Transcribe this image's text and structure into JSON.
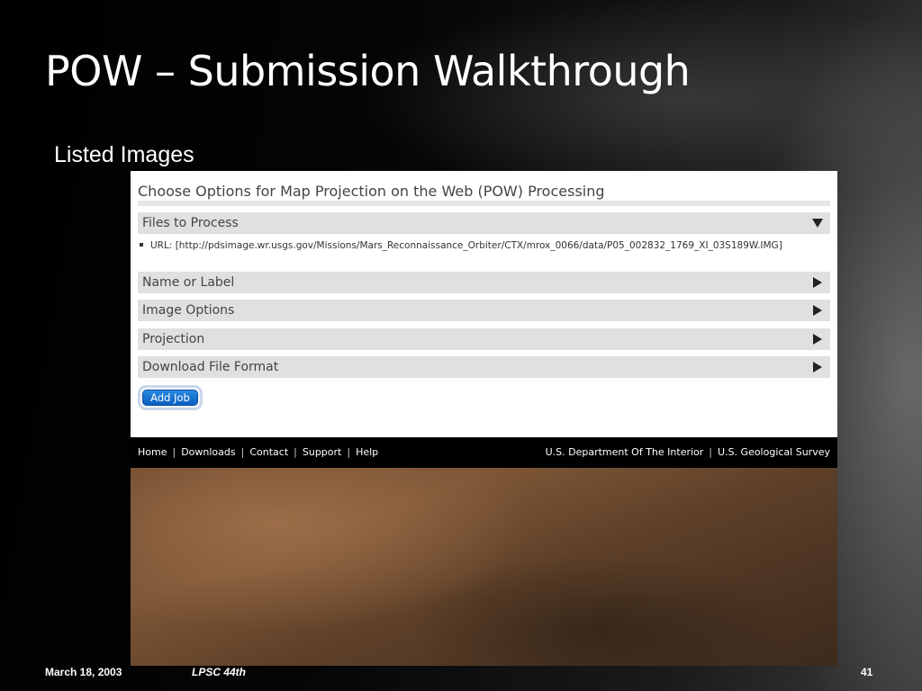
{
  "slide": {
    "title": "POW – Submission Walkthrough",
    "subtitle": "Listed Images",
    "footer": {
      "date": "March 18, 2003",
      "conference": "LPSC 44th",
      "page_number": "41"
    }
  },
  "form": {
    "heading": "Choose Options for Map Projection on the Web (POW) Processing",
    "sections": [
      {
        "label": "Files to Process",
        "state": "expanded",
        "icon": "triangle-down-icon"
      },
      {
        "label": "Name or Label",
        "state": "collapsed",
        "icon": "triangle-right-icon"
      },
      {
        "label": "Image Options",
        "state": "collapsed",
        "icon": "triangle-right-icon"
      },
      {
        "label": "Projection",
        "state": "collapsed",
        "icon": "triangle-right-icon"
      },
      {
        "label": "Download File Format",
        "state": "collapsed",
        "icon": "triangle-right-icon"
      }
    ],
    "files": [
      "URL: [http://pdsimage.wr.usgs.gov/Missions/Mars_Reconnaissance_Orbiter/CTX/mrox_0066/data/P05_002832_1769_XI_03S189W.IMG]"
    ],
    "add_job_label": "Add Job",
    "accent_color": "#0a5fc0"
  },
  "site_footer": {
    "links": [
      "Home",
      "Downloads",
      "Contact",
      "Support",
      "Help"
    ],
    "separator": "|",
    "right_links": [
      "U.S. Department Of The Interior",
      "U.S. Geological Survey"
    ]
  }
}
